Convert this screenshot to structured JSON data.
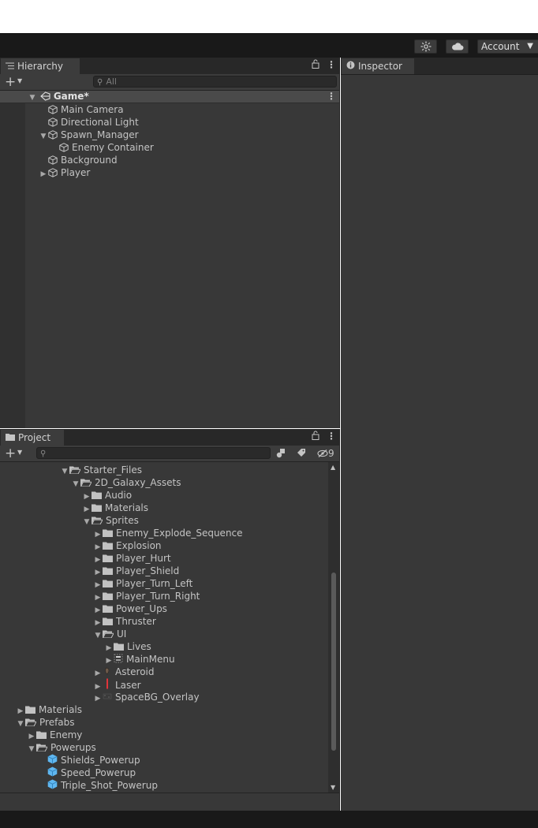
{
  "topbar": {
    "account_label": "Account"
  },
  "hierarchy": {
    "tab_label": "Hierarchy",
    "search_placeholder": "All",
    "scene_name": "Game*",
    "items": [
      {
        "label": "Main Camera",
        "depth": 1,
        "expander": "none"
      },
      {
        "label": "Directional Light",
        "depth": 1,
        "expander": "none"
      },
      {
        "label": "Spawn_Manager",
        "depth": 1,
        "expander": "expanded"
      },
      {
        "label": "Enemy Container",
        "depth": 2,
        "expander": "none"
      },
      {
        "label": "Background",
        "depth": 1,
        "expander": "none"
      },
      {
        "label": "Player",
        "depth": 1,
        "expander": "collapsed"
      }
    ]
  },
  "inspector": {
    "tab_label": "Inspector"
  },
  "project": {
    "tab_label": "Project",
    "hidden_count": "9",
    "items": [
      {
        "label": "Starter_Files",
        "depth": 5,
        "kind": "folder-open",
        "expander": "expanded"
      },
      {
        "label": "2D_Galaxy_Assets",
        "depth": 6,
        "kind": "folder-open",
        "expander": "expanded"
      },
      {
        "label": "Audio",
        "depth": 7,
        "kind": "folder",
        "expander": "collapsed"
      },
      {
        "label": "Materials",
        "depth": 7,
        "kind": "folder",
        "expander": "collapsed"
      },
      {
        "label": "Sprites",
        "depth": 7,
        "kind": "folder-open",
        "expander": "expanded"
      },
      {
        "label": "Enemy_Explode_Sequence",
        "depth": 8,
        "kind": "folder",
        "expander": "collapsed"
      },
      {
        "label": "Explosion",
        "depth": 8,
        "kind": "folder",
        "expander": "collapsed"
      },
      {
        "label": "Player_Hurt",
        "depth": 8,
        "kind": "folder",
        "expander": "collapsed"
      },
      {
        "label": "Player_Shield",
        "depth": 8,
        "kind": "folder",
        "expander": "collapsed"
      },
      {
        "label": "Player_Turn_Left",
        "depth": 8,
        "kind": "folder",
        "expander": "collapsed"
      },
      {
        "label": "Player_Turn_Right",
        "depth": 8,
        "kind": "folder",
        "expander": "collapsed"
      },
      {
        "label": "Power_Ups",
        "depth": 8,
        "kind": "folder",
        "expander": "collapsed"
      },
      {
        "label": "Thruster",
        "depth": 8,
        "kind": "folder",
        "expander": "collapsed"
      },
      {
        "label": "UI",
        "depth": 8,
        "kind": "folder-open",
        "expander": "expanded"
      },
      {
        "label": "Lives",
        "depth": 9,
        "kind": "folder",
        "expander": "collapsed"
      },
      {
        "label": "MainMenu",
        "depth": 9,
        "kind": "sprite-menu",
        "expander": "collapsed"
      },
      {
        "label": "Asteroid",
        "depth": 8,
        "kind": "sprite-asteroid",
        "expander": "collapsed"
      },
      {
        "label": "Laser",
        "depth": 8,
        "kind": "sprite-laser",
        "expander": "collapsed"
      },
      {
        "label": "SpaceBG_Overlay",
        "depth": 8,
        "kind": "sprite-bg",
        "expander": "collapsed"
      },
      {
        "label": "Materials",
        "depth": 1,
        "kind": "folder",
        "expander": "collapsed"
      },
      {
        "label": "Prefabs",
        "depth": 1,
        "kind": "folder-open",
        "expander": "expanded"
      },
      {
        "label": "Enemy",
        "depth": 2,
        "kind": "folder",
        "expander": "collapsed"
      },
      {
        "label": "Powerups",
        "depth": 2,
        "kind": "folder-open",
        "expander": "expanded"
      },
      {
        "label": "Shields_Powerup",
        "depth": 3,
        "kind": "prefab",
        "expander": "none"
      },
      {
        "label": "Speed_Powerup",
        "depth": 3,
        "kind": "prefab",
        "expander": "none"
      },
      {
        "label": "Triple_Shot_Powerup",
        "depth": 3,
        "kind": "prefab",
        "expander": "none"
      },
      {
        "label": "",
        "depth": 2,
        "kind": "prefab",
        "expander": "none"
      }
    ]
  },
  "colors": {
    "panel_bg": "#383838",
    "tab_strip": "#282828",
    "prefab_blue": "#5fb7f0",
    "laser_red": "#e0343a"
  }
}
